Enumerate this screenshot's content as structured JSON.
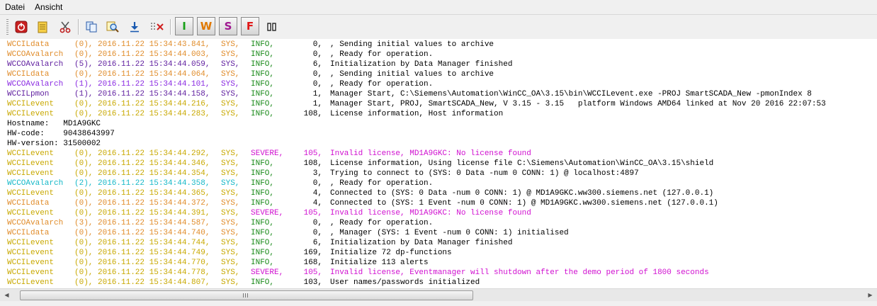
{
  "menu": [
    "Datei",
    "Ansicht"
  ],
  "toolbar": {
    "icons": [
      "power-icon",
      "notepad-icon",
      "scissors-icon",
      "copy-icon",
      "find-icon",
      "download-arrow-icon",
      "delete-icon",
      "columns-icon"
    ],
    "levels": [
      {
        "label": "I",
        "color": "#18a018"
      },
      {
        "label": "W",
        "color": "#e07800"
      },
      {
        "label": "S",
        "color": "#a01890"
      },
      {
        "label": "F",
        "color": "#e01818"
      }
    ]
  },
  "colors": {
    "WCCILdata": "#e08c2a",
    "WCCOAvalarch_0": "#e08c2a",
    "WCCOAvalarch_1": "#8a2be2",
    "WCCOAvalarch_2": "#15b8c8",
    "WCCOAvalarch_3": "#e08c2a",
    "WCCOAvalarch_5": "#6020a0",
    "WCCILpmon": "#6020a0",
    "WCCILevent": "#c8a800",
    "INFO": "#1a8a1a",
    "SEVERE": "#d010d0",
    "severe_msg": "#d010d0",
    "plain": "#000000"
  },
  "log": [
    {
      "name": "WCCILdata",
      "num": "(0),",
      "time": "2016.11.22 15:34:43.841,",
      "sys": "SYS,",
      "level": "INFO,",
      "code": "0,",
      "msg": ", Sending initial values to archive",
      "color": "#e08c2a"
    },
    {
      "name": "WCCOAvalarch",
      "num": "(0),",
      "time": "2016.11.22 15:34:44.003,",
      "sys": "SYS,",
      "level": "INFO,",
      "code": "0,",
      "msg": ", Ready for operation.",
      "color": "#e08c2a"
    },
    {
      "name": "WCCOAvalarch",
      "num": "(5),",
      "time": "2016.11.22 15:34:44.059,",
      "sys": "SYS,",
      "level": "INFO,",
      "code": "6,",
      "msg": "Initialization by Data Manager finished",
      "color": "#6020a0"
    },
    {
      "name": "WCCILdata",
      "num": "(0),",
      "time": "2016.11.22 15:34:44.064,",
      "sys": "SYS,",
      "level": "INFO,",
      "code": "0,",
      "msg": ", Sending initial values to archive",
      "color": "#e08c2a"
    },
    {
      "name": "WCCOAvalarch",
      "num": "(1),",
      "time": "2016.11.22 15:34:44.101,",
      "sys": "SYS,",
      "level": "INFO,",
      "code": "0,",
      "msg": ", Ready for operation.",
      "color": "#8a2be2"
    },
    {
      "name": "WCCILpmon",
      "num": "(1),",
      "time": "2016.11.22 15:34:44.158,",
      "sys": "SYS,",
      "level": "INFO,",
      "code": "1,",
      "msg": "Manager Start, C:\\Siemens\\Automation\\WinCC_OA\\3.15\\bin\\WCCILevent.exe -PROJ SmartSCADA_New -pmonIndex 8",
      "color": "#6020a0"
    },
    {
      "name": "WCCILevent",
      "num": "(0),",
      "time": "2016.11.22 15:34:44.216,",
      "sys": "SYS,",
      "level": "INFO,",
      "code": "1,",
      "msg": "Manager Start, PROJ, SmartSCADA_New, V 3.15 - 3.15   platform Windows AMD64 linked at Nov 20 2016 22:07:53",
      "color": "#c8a800"
    },
    {
      "name": "WCCILevent",
      "num": "(0),",
      "time": "2016.11.22 15:34:44.283,",
      "sys": "SYS,",
      "level": "INFO,",
      "code": "108,",
      "msg": "License information, Host information",
      "color": "#c8a800"
    },
    {
      "plain": "Hostname:   MD1A9GKC"
    },
    {
      "plain": "HW-code:    90438643997"
    },
    {
      "plain": "HW-version: 31500002"
    },
    {
      "name": "WCCILevent",
      "num": "(0),",
      "time": "2016.11.22 15:34:44.292,",
      "sys": "SYS,",
      "level": "SEVERE,",
      "code": "105,",
      "msg": "Invalid license, MD1A9GKC: No license found",
      "color": "#c8a800",
      "severe": true
    },
    {
      "name": "WCCILevent",
      "num": "(0),",
      "time": "2016.11.22 15:34:44.346,",
      "sys": "SYS,",
      "level": "INFO,",
      "code": "108,",
      "msg": "License information, Using license file C:\\Siemens\\Automation\\WinCC_OA\\3.15\\shield",
      "color": "#c8a800"
    },
    {
      "name": "WCCILevent",
      "num": "(0),",
      "time": "2016.11.22 15:34:44.354,",
      "sys": "SYS,",
      "level": "INFO,",
      "code": "3,",
      "msg": "Trying to connect to (SYS: 0 Data -num 0 CONN: 1) @ localhost:4897",
      "color": "#c8a800"
    },
    {
      "name": "WCCOAvalarch",
      "num": "(2),",
      "time": "2016.11.22 15:34:44.358,",
      "sys": "SYS,",
      "level": "INFO,",
      "code": "0,",
      "msg": ", Ready for operation.",
      "color": "#15b8c8"
    },
    {
      "name": "WCCILevent",
      "num": "(0),",
      "time": "2016.11.22 15:34:44.365,",
      "sys": "SYS,",
      "level": "INFO,",
      "code": "4,",
      "msg": "Connected to (SYS: 0 Data -num 0 CONN: 1) @ MD1A9GKC.ww300.siemens.net (127.0.0.1)",
      "color": "#c8a800"
    },
    {
      "name": "WCCILdata",
      "num": "(0),",
      "time": "2016.11.22 15:34:44.372,",
      "sys": "SYS,",
      "level": "INFO,",
      "code": "4,",
      "msg": "Connected to (SYS: 1 Event -num 0 CONN: 1) @ MD1A9GKC.ww300.siemens.net (127.0.0.1)",
      "color": "#e08c2a"
    },
    {
      "name": "WCCILevent",
      "num": "(0),",
      "time": "2016.11.22 15:34:44.391,",
      "sys": "SYS,",
      "level": "SEVERE,",
      "code": "105,",
      "msg": "Invalid license, MD1A9GKC: No license found",
      "color": "#c8a800",
      "severe": true
    },
    {
      "name": "WCCOAvalarch",
      "num": "(3),",
      "time": "2016.11.22 15:34:44.587,",
      "sys": "SYS,",
      "level": "INFO,",
      "code": "0,",
      "msg": ", Ready for operation.",
      "color": "#e08c2a"
    },
    {
      "name": "WCCILdata",
      "num": "(0),",
      "time": "2016.11.22 15:34:44.740,",
      "sys": "SYS,",
      "level": "INFO,",
      "code": "0,",
      "msg": ", Manager (SYS: 1 Event -num 0 CONN: 1) initialised",
      "color": "#e08c2a"
    },
    {
      "name": "WCCILevent",
      "num": "(0),",
      "time": "2016.11.22 15:34:44.744,",
      "sys": "SYS,",
      "level": "INFO,",
      "code": "6,",
      "msg": "Initialization by Data Manager finished",
      "color": "#c8a800"
    },
    {
      "name": "WCCILevent",
      "num": "(0),",
      "time": "2016.11.22 15:34:44.749,",
      "sys": "SYS,",
      "level": "INFO,",
      "code": "169,",
      "msg": "Initialize 72 dp-functions",
      "color": "#c8a800"
    },
    {
      "name": "WCCILevent",
      "num": "(0),",
      "time": "2016.11.22 15:34:44.770,",
      "sys": "SYS,",
      "level": "INFO,",
      "code": "168,",
      "msg": "Initialize 113 alerts",
      "color": "#c8a800"
    },
    {
      "name": "WCCILevent",
      "num": "(0),",
      "time": "2016.11.22 15:34:44.778,",
      "sys": "SYS,",
      "level": "SEVERE,",
      "code": "105,",
      "msg": "Invalid license, Eventmanager will shutdown after the demo period of 1800 seconds",
      "color": "#c8a800",
      "severe": true
    },
    {
      "name": "WCCILevent",
      "num": "(0),",
      "time": "2016.11.22 15:34:44.807,",
      "sys": "SYS,",
      "level": "INFO,",
      "code": "103,",
      "msg": "User names/passwords initialized",
      "color": "#c8a800"
    }
  ],
  "scrollbar": {
    "left_arrow": "◀",
    "right_arrow": "▶",
    "grip": "|||"
  }
}
